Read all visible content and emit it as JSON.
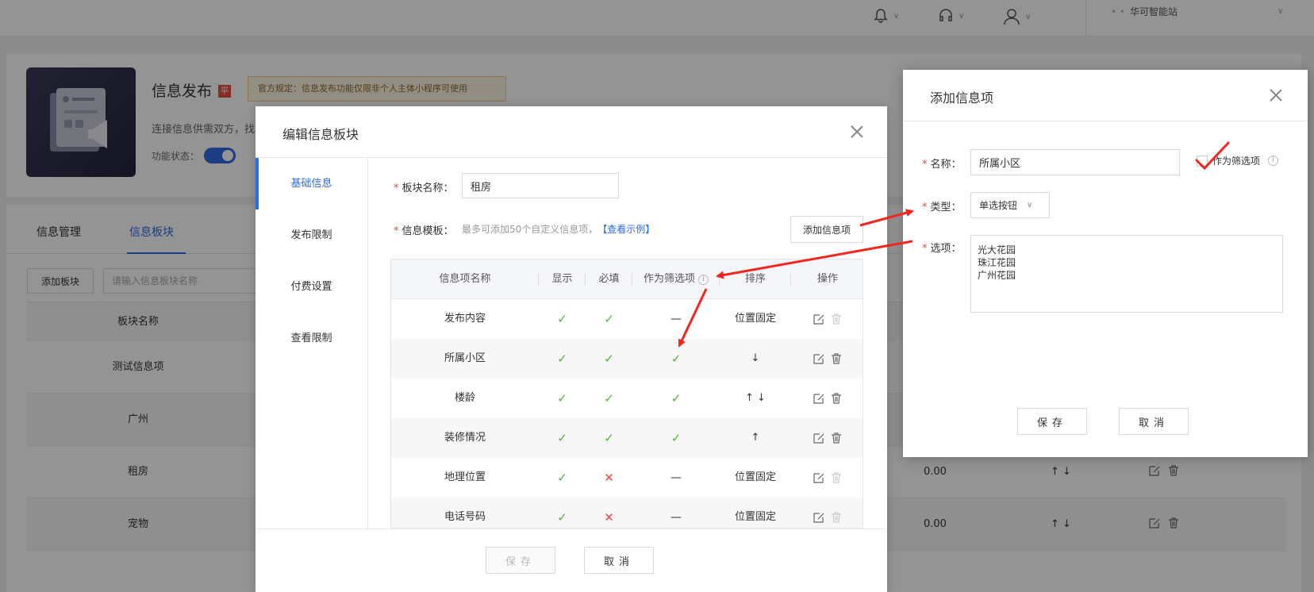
{
  "topbar": {
    "store_name": "华可智能站"
  },
  "hero": {
    "title": "信息发布",
    "badge": "平",
    "notice": "官方规定：信息发布功能仅限非个人主体小程序可使用",
    "desc": "连接信息供需双方，找",
    "status_label": "功能状态："
  },
  "main": {
    "tabs": [
      {
        "label": "信息管理"
      },
      {
        "label": "信息板块"
      }
    ],
    "add_block_label": "添加板块",
    "search_placeholder": "请输入信息板块名称",
    "table_header": "板块名称",
    "rows": [
      {
        "name": "测试信息项",
        "price": "",
        "sort": ""
      },
      {
        "name": "广州",
        "price": "",
        "sort": ""
      },
      {
        "name": "租房",
        "price": "0.00",
        "sort": "↑ ↓"
      },
      {
        "name": "宠物",
        "price": "0.00",
        "sort": "↑ ↓"
      }
    ]
  },
  "edit_dialog": {
    "title": "编辑信息板块",
    "side": [
      {
        "label": "基础信息"
      },
      {
        "label": "发布限制"
      },
      {
        "label": "付费设置"
      },
      {
        "label": "查看限制"
      }
    ],
    "name_label": "板块名称：",
    "name_value": "租房",
    "template_label": "信息模板：",
    "template_hint": "最多可添加50个自定义信息项，",
    "template_link": "【查看示例】",
    "add_item_label": "添加信息项",
    "columns": [
      "信息项名称",
      "显示",
      "必填",
      "作为筛选项",
      "排序",
      "操作"
    ],
    "rows": [
      {
        "name": "发布内容",
        "show": "✓",
        "required": "✓",
        "filter": "—",
        "sort": "位置固定"
      },
      {
        "name": "所属小区",
        "show": "✓",
        "required": "✓",
        "filter": "✓",
        "sort": "↓"
      },
      {
        "name": "楼龄",
        "show": "✓",
        "required": "✓",
        "filter": "✓",
        "sort": "↑ ↓"
      },
      {
        "name": "装修情况",
        "show": "✓",
        "required": "✓",
        "filter": "✓",
        "sort": "↑"
      },
      {
        "name": "地理位置",
        "show": "✓",
        "required": "✕",
        "filter": "—",
        "sort": "位置固定"
      },
      {
        "name": "电话号码",
        "show": "✓",
        "required": "✕",
        "filter": "—",
        "sort": "位置固定"
      }
    ],
    "save_label": "保存",
    "cancel_label": "取消"
  },
  "add_dialog": {
    "title": "添加信息项",
    "name_label": "名称：",
    "name_value": "所属小区",
    "filter_label": "作为筛选项",
    "type_label": "类型：",
    "type_value": "单选按钮",
    "options_label": "选项：",
    "options_value": "光大花园\n珠江花园\n广州花园",
    "save_label": "保存",
    "cancel_label": "取消"
  },
  "colors": {
    "accent": "#2d6cdf",
    "success": "#52b43a",
    "danger": "#e84c3d",
    "annotation": "#f2261f"
  }
}
